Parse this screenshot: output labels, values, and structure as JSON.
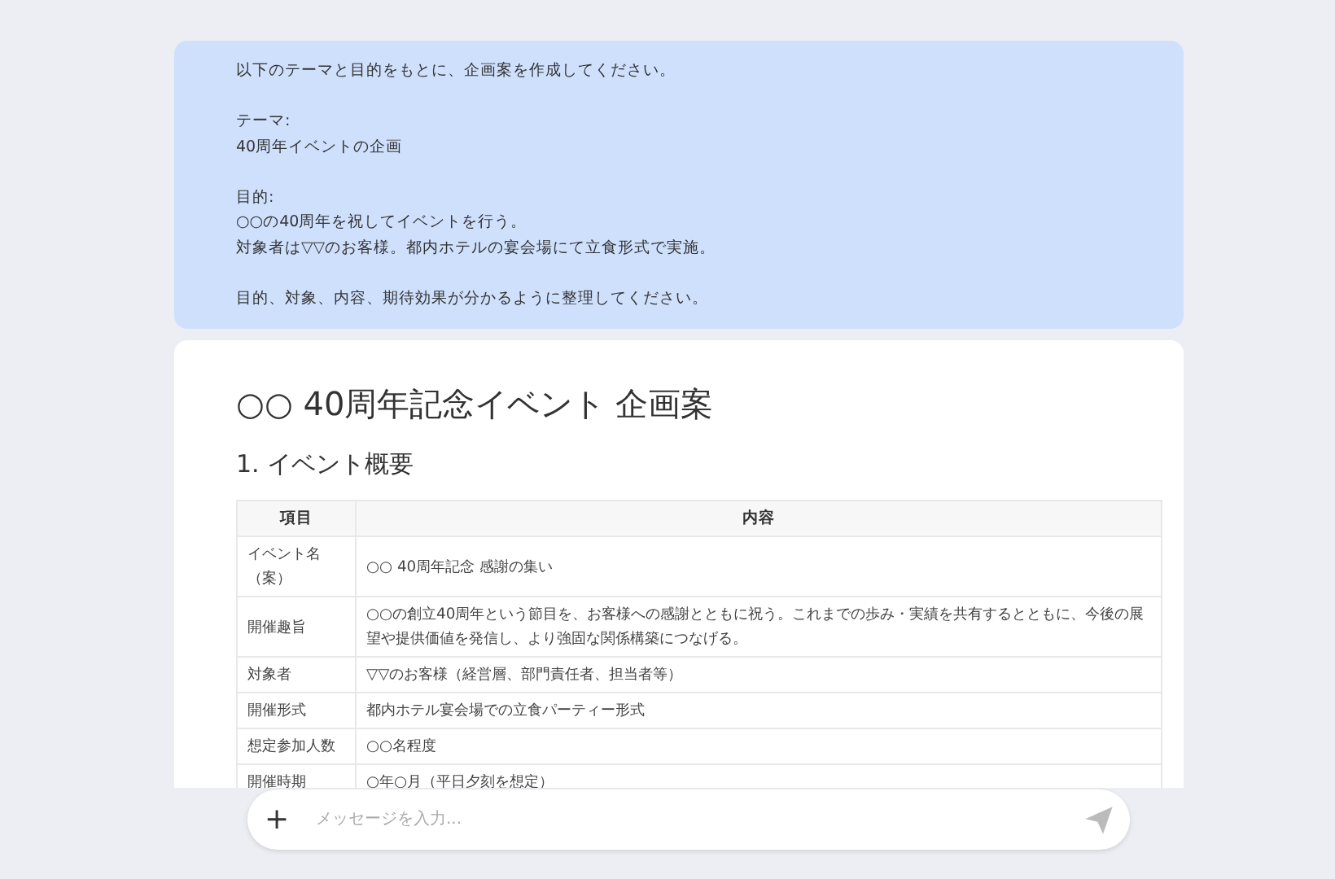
{
  "user_message": {
    "paragraphs": [
      [
        "以下のテーマと目的をもとに、企画案を作成してください。"
      ],
      [
        "テーマ:",
        "40周年イベントの企画"
      ],
      [
        "目的:",
        "○○の40周年を祝してイベントを行う。",
        "対象者は▽▽のお客様。都内ホテルの宴会場にて立食形式で実施。"
      ],
      [
        "目的、対象、内容、期待効果が分かるように整理してください。"
      ]
    ]
  },
  "response": {
    "title": "○○ 40周年記念イベント 企画案",
    "section": "1. イベント概要",
    "table": {
      "columns": [
        "項目",
        "内容"
      ],
      "rows": [
        [
          "イベント名（案）",
          "○○ 40周年記念 感謝の集い"
        ],
        [
          "開催趣旨",
          "○○の創立40周年という節目を、お客様への感謝とともに祝う。これまでの歩み・実績を共有するとともに、今後の展望や提供価値を発信し、より強固な関係構築につなげる。"
        ],
        [
          "対象者",
          "▽▽のお客様（経営層、部門責任者、担当者等）"
        ],
        [
          "開催形式",
          "都内ホテル宴会場での立食パーティー形式"
        ],
        [
          "想定参加人数",
          "○○名程度"
        ],
        [
          "開催時期",
          "○年○月（平日夕刻を想定）"
        ]
      ]
    }
  },
  "composer": {
    "add": "+",
    "placeholder": "メッセージを入力..."
  }
}
